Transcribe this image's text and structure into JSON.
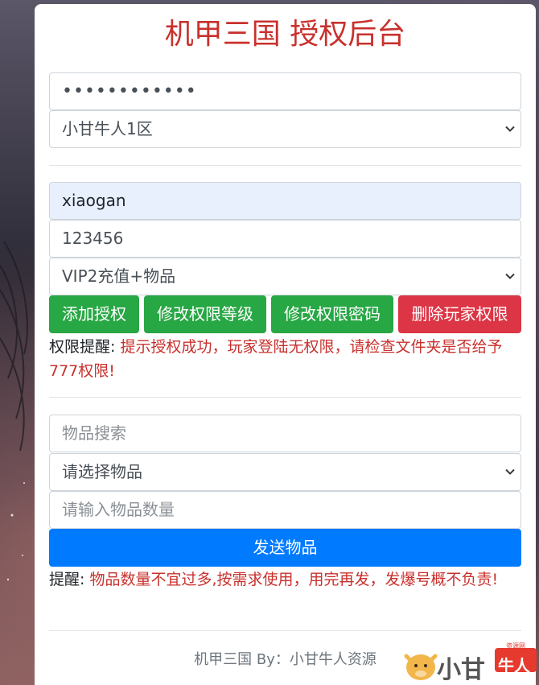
{
  "title": "机甲三国 授权后台",
  "auth": {
    "password_mask": "••••••••••••",
    "server": "小甘牛人1区"
  },
  "player": {
    "account": "xiaogan",
    "password": "123456",
    "vip_option": "VIP2充值+物品"
  },
  "buttons": {
    "add": "添加授权",
    "modify_level": "修改权限等级",
    "modify_password": "修改权限密码",
    "delete": "删除玩家权限"
  },
  "permission_notice": {
    "label": "权限提醒: ",
    "text": "提示授权成功，玩家登陆无权限，请检查文件夹是否给予777权限!"
  },
  "items": {
    "search_placeholder": "物品搜索",
    "select": "请选择物品",
    "quantity_placeholder": "请输入物品数量",
    "send": "发送物品"
  },
  "item_notice": {
    "label": "提醒: ",
    "text": "物品数量不宜过多,按需求使用，用完再发，发爆号概不负责!"
  },
  "footer": "机甲三国 By：小甘牛人资源",
  "logo": {
    "text": "小甘",
    "badge": "牛人",
    "small": "资源网"
  },
  "colors": {
    "title": "#c8312d",
    "green": "#28a745",
    "red": "#dc3545",
    "blue": "#007bff"
  }
}
